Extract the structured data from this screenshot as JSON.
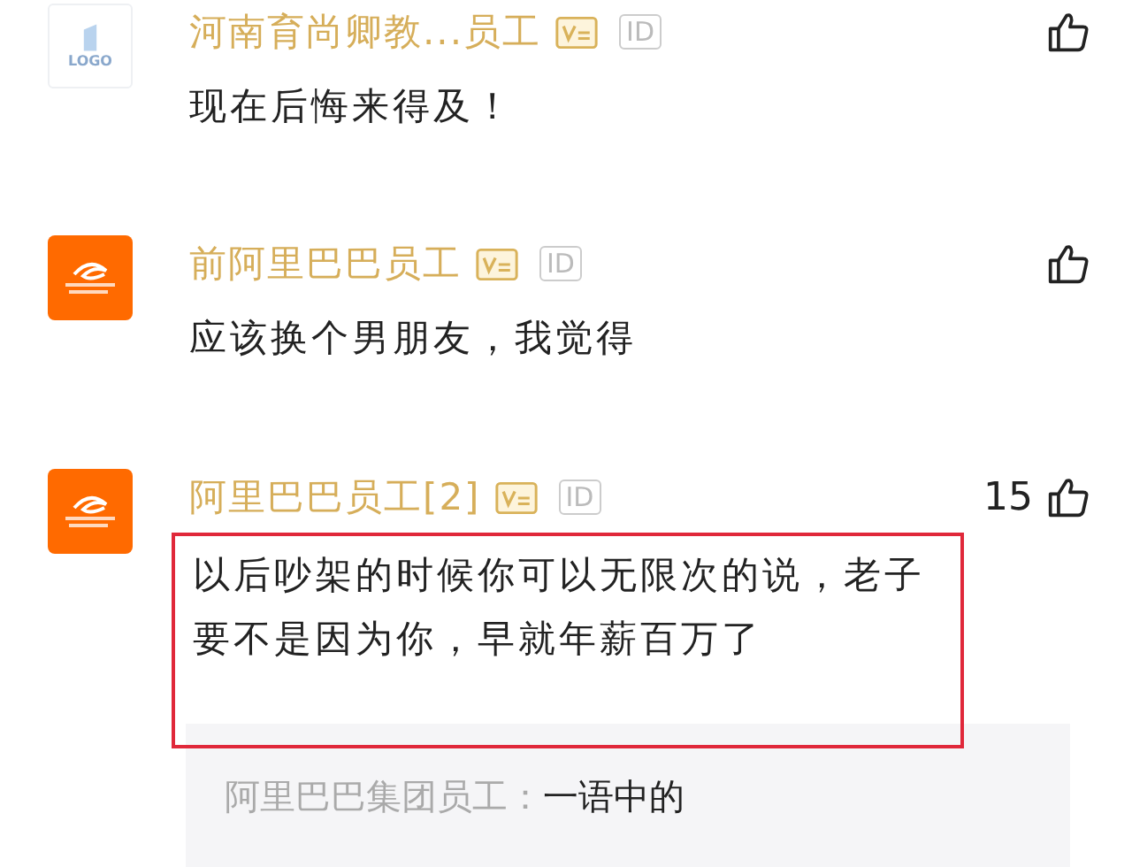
{
  "comments": [
    {
      "avatar": {
        "kind": "placeholder",
        "text": "LOGO"
      },
      "author": "河南育尚卿教...员工",
      "verified": true,
      "id_badge": "ID",
      "text": "现在后悔来得及！",
      "highlighted": false
    },
    {
      "avatar": {
        "kind": "company"
      },
      "author": "前阿里巴巴员工",
      "verified": true,
      "id_badge": "ID",
      "text": "应该换个男朋友，我觉得",
      "highlighted": false
    },
    {
      "avatar": {
        "kind": "company"
      },
      "author": "阿里巴巴员工[2]",
      "verified": true,
      "id_badge": "ID",
      "likes": "15",
      "text": "以后吵架的时候你可以无限次的说，老子要不是因为你，早就年薪百万了",
      "highlighted": true,
      "replies": [
        {
          "author": "阿里巴巴集团员工：",
          "text": "一语中的"
        }
      ]
    }
  ]
}
